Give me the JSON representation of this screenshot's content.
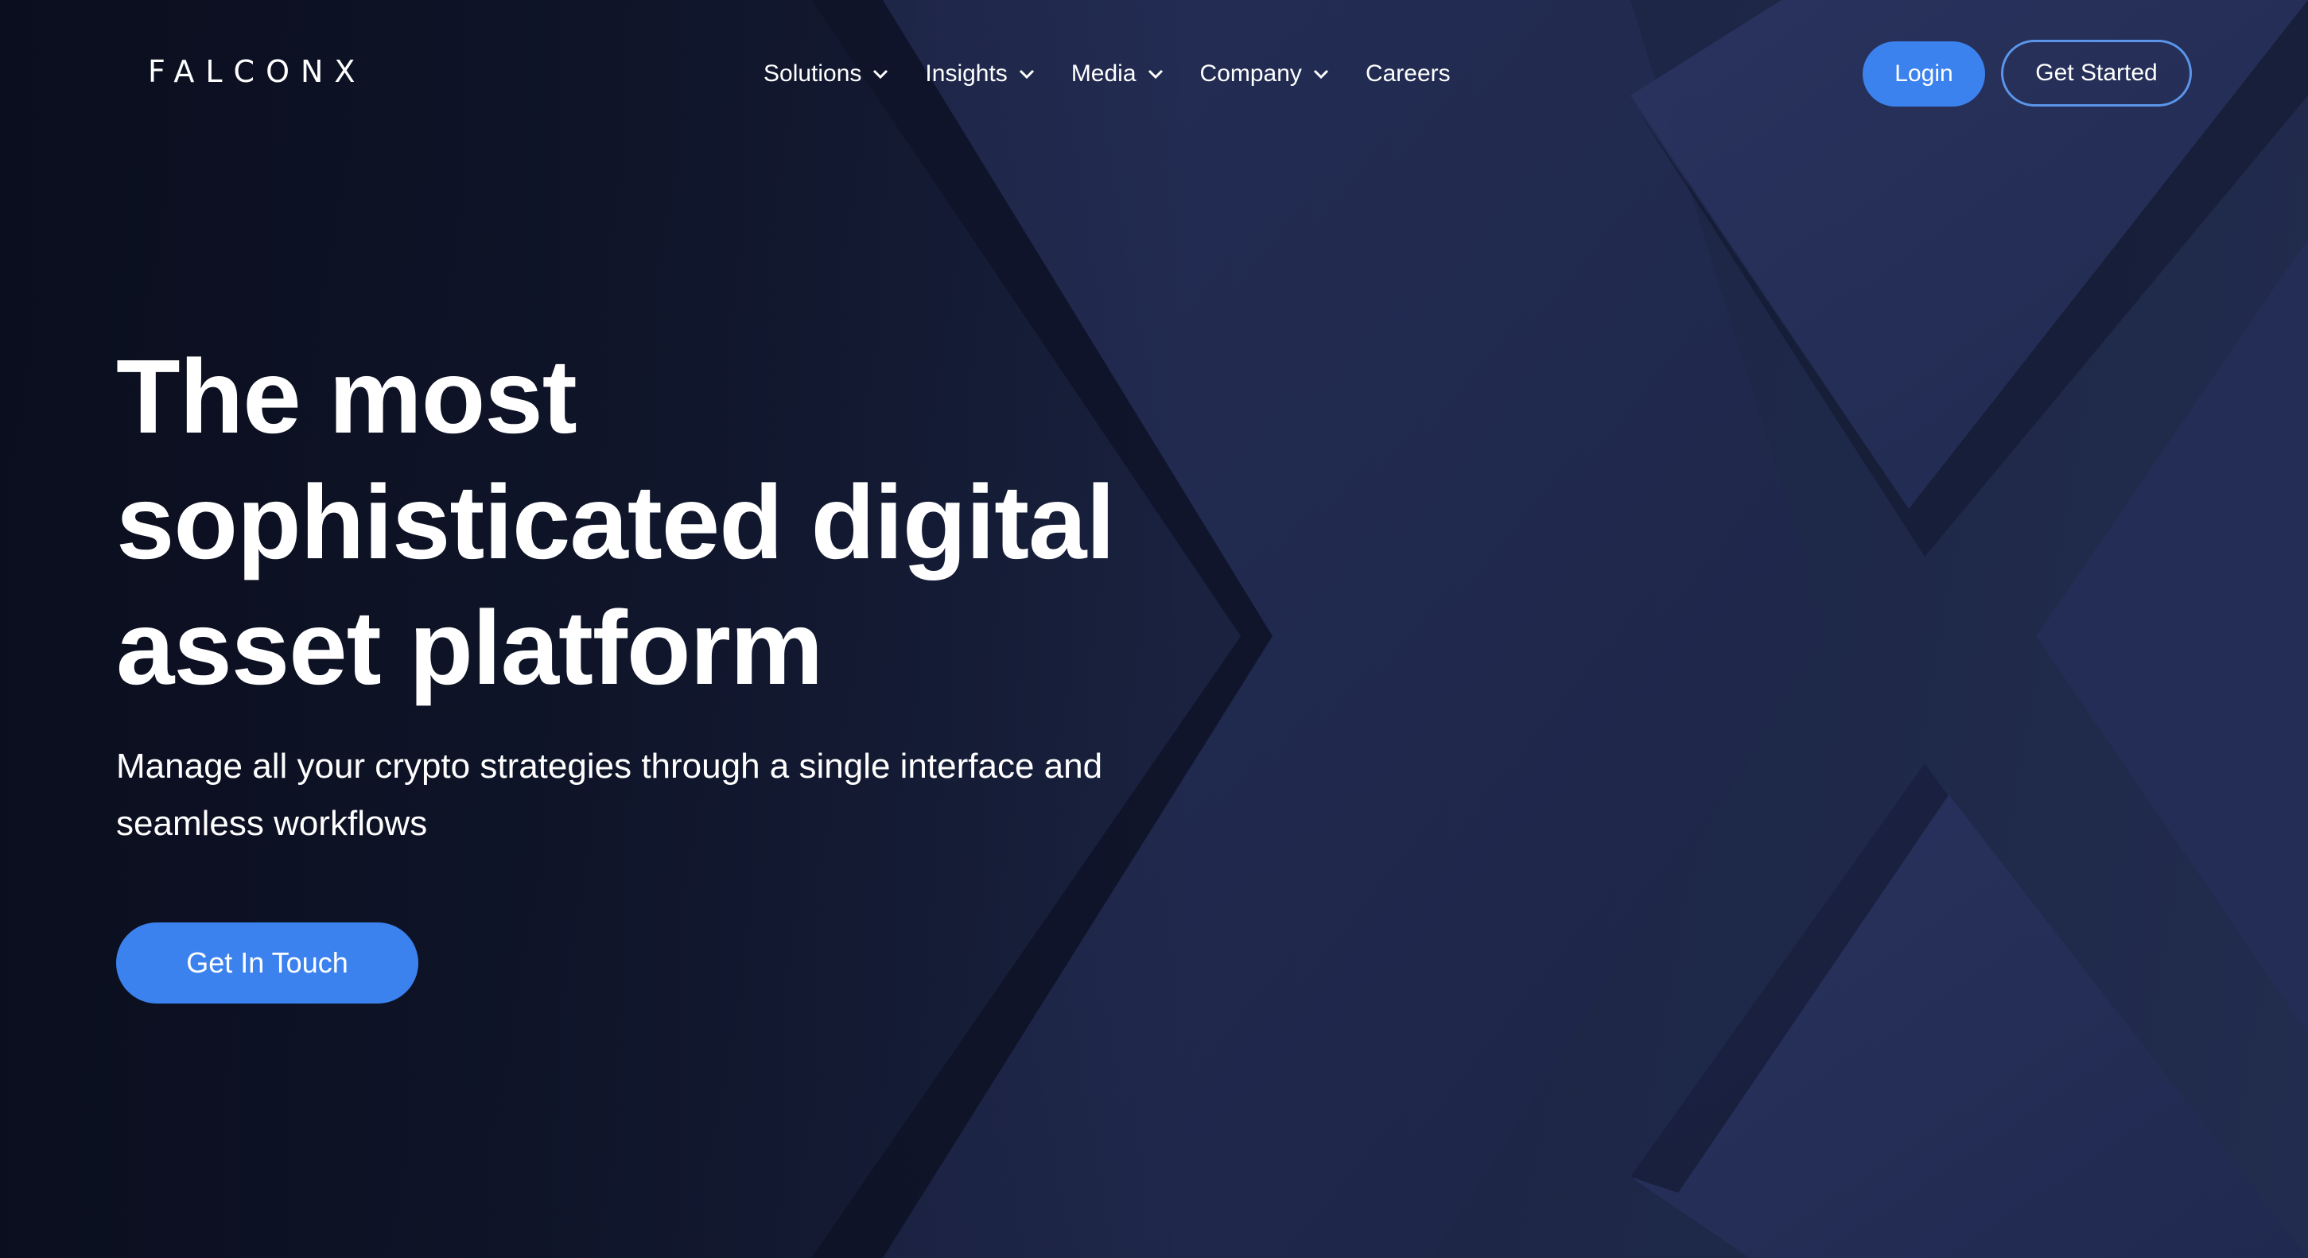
{
  "brand": {
    "logo_text": "FALCONX",
    "accent_color": "#3b82ee"
  },
  "nav": {
    "items": [
      {
        "label": "Solutions",
        "has_dropdown": true
      },
      {
        "label": "Insights",
        "has_dropdown": true
      },
      {
        "label": "Media",
        "has_dropdown": true
      },
      {
        "label": "Company",
        "has_dropdown": true
      },
      {
        "label": "Careers",
        "has_dropdown": false
      }
    ],
    "dropdown_icon": "chevron-down-icon"
  },
  "header_actions": {
    "login_label": "Login",
    "get_started_label": "Get Started"
  },
  "hero": {
    "title_lines": [
      "The most",
      "sophisticated digital",
      "asset platform"
    ],
    "subtitle_lines": [
      "Manage all your crypto strategies through a single interface and",
      "seamless workflows"
    ],
    "cta_label": "Get In Touch"
  }
}
